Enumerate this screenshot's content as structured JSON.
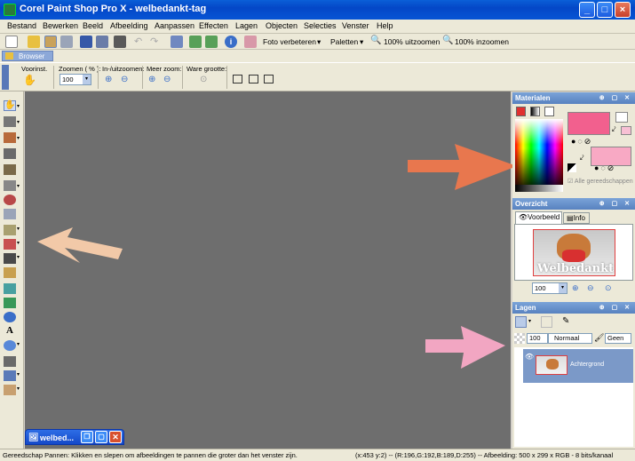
{
  "window": {
    "title": "Corel Paint Shop Pro X - welbedankt-tag",
    "buttons": [
      "_",
      "□",
      "×"
    ]
  },
  "menu": [
    "Bestand",
    "Bewerken",
    "Beeld",
    "Afbeelding",
    "Aanpassen",
    "Effecten",
    "Lagen",
    "Objecten",
    "Selecties",
    "Venster",
    "Help"
  ],
  "toolbar": {
    "enhance_photo": "Foto verbeteren",
    "palettes": "Paletten",
    "zoom_out": "100% uitzoomen",
    "zoom_in": "100% inzoomen"
  },
  "browser_tab": "Browser",
  "options": {
    "preset": "Voorinst.",
    "zoom_label": "Zoomen ( % ):",
    "zoom_value": "100",
    "zoom_inout": "In-/uitzoomen:",
    "more_zoom": "Meer zoom:",
    "actual_size": "Ware grootte:"
  },
  "panels": {
    "materials": {
      "title": "Materialen",
      "all_tools": "Alle gereedschappen",
      "colors": {
        "foreground": "#f2608e",
        "background": "#f8a9c4"
      }
    },
    "overview": {
      "title": "Overzicht",
      "tabs": [
        "Voorbeeld",
        "Info"
      ],
      "zoom_value": "100",
      "thumb_caption": "Welbedankt"
    },
    "layers": {
      "title": "Lagen",
      "opacity": "100",
      "blend_mode": "Normaal",
      "mask": "Geen",
      "layer_name": "Achtergrond"
    }
  },
  "minimized_window": {
    "title": "welbed..."
  },
  "status": {
    "left": "Gereedschap Pannen: Klikken en slepen om afbeeldingen te pannen die groter dan het venster zijn.",
    "right": "(x:453 y:2) -- (R:196,G:192,B:189,D:255) -- Afbeelding:  500 x 299 x RGB - 8 bits/kanaal"
  },
  "annotations": {
    "arrow_left_color": "#f2c9a8",
    "arrow_materials_color": "#e8774e",
    "arrow_layers_color": "#f2a6c2"
  }
}
